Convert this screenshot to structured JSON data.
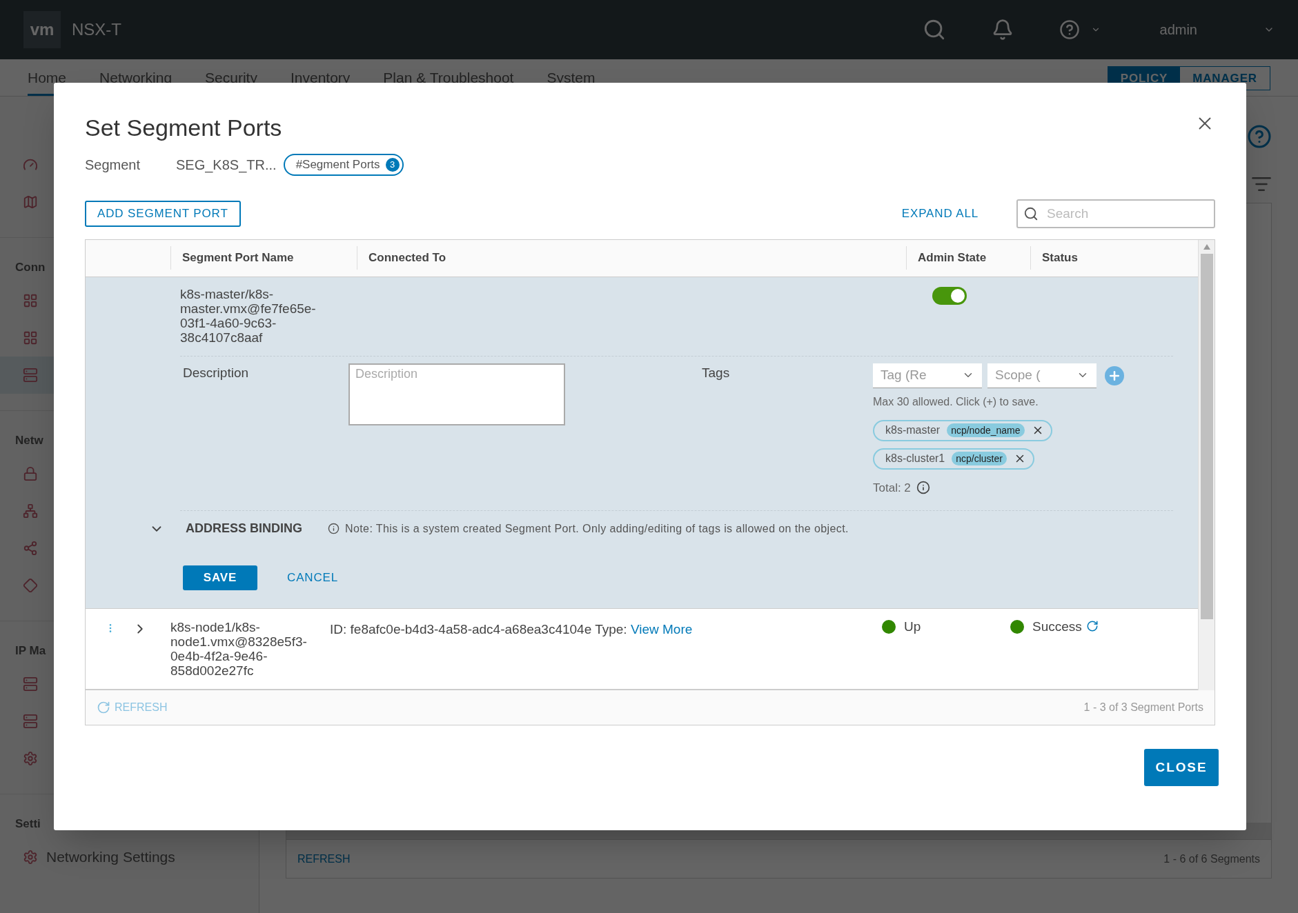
{
  "header": {
    "logo": "vm",
    "app_name": "NSX-T",
    "user": "admin"
  },
  "nav": {
    "tabs": [
      {
        "label": "Home",
        "selected": true
      },
      {
        "label": "Networking",
        "selected": false
      },
      {
        "label": "Security",
        "selected": false
      },
      {
        "label": "Inventory",
        "selected": false
      },
      {
        "label": "Plan & Troubleshoot",
        "selected": false
      },
      {
        "label": "System",
        "selected": false
      }
    ],
    "modes": [
      {
        "label": "POLICY",
        "selected": true
      },
      {
        "label": "MANAGER",
        "selected": false
      }
    ]
  },
  "sidebar": {
    "groups": [
      {
        "items": [
          {
            "selected": false
          },
          {
            "selected": false
          }
        ]
      },
      {
        "heading": "Conn",
        "items": [
          {
            "selected": false
          },
          {
            "selected": false
          },
          {
            "selected": true
          }
        ]
      },
      {
        "heading": "Netw",
        "items": [
          {
            "selected": false
          },
          {
            "selected": false
          },
          {
            "selected": false
          },
          {
            "selected": false
          }
        ]
      },
      {
        "heading": "IP Ma",
        "items": [
          {
            "selected": false
          },
          {
            "selected": false
          },
          {
            "selected": false
          }
        ]
      },
      {
        "heading": "Setti",
        "items": [
          {
            "label": "Networking Settings",
            "selected": false
          }
        ]
      }
    ]
  },
  "background_table": {
    "refresh": "REFRESH",
    "count": "1 - 6 of 6 Segments"
  },
  "dialog": {
    "title": "Set Segment Ports",
    "segment_label": "Segment",
    "segment_value": "SEG_K8S_TR...",
    "ports_badge": {
      "label": "#Segment Ports",
      "count": "3"
    },
    "add_button": "ADD SEGMENT PORT",
    "expand_all": "EXPAND ALL",
    "search": {
      "placeholder": "Search"
    },
    "columns": [
      "Segment Port Name",
      "Connected To",
      "Admin State",
      "Status"
    ],
    "rows": [
      {
        "expanded": true,
        "name": "k8s-master/k8s-master.vmx@fe7fe65e-03f1-4a60-9c63-38c4107c8aaf",
        "admin_on": true,
        "detail": {
          "description_label": "Description",
          "description_placeholder": "Description",
          "tags_label": "Tags",
          "tag_placeholder": "Tag (Re",
          "scope_placeholder": "Scope (",
          "hint": "Max 30 allowed. Click (+) to save.",
          "tags": [
            {
              "tag": "k8s-master",
              "scope": "ncp/node_name"
            },
            {
              "tag": "k8s-cluster1",
              "scope": "ncp/cluster"
            }
          ],
          "total": "Total: 2",
          "address_binding": {
            "label": "ADDRESS BINDING",
            "expanded": true
          },
          "note": "Note: This is a system created Segment Port. Only adding/editing of tags is allowed on the object.",
          "save": "SAVE",
          "cancel": "CANCEL"
        }
      },
      {
        "expanded": false,
        "name": "k8s-node1/k8s-node1.vmx@8328e5f3-0e4b-4f2a-9e46-858d002e27fc",
        "connected_to": "ID: fe8afc0e-b4d3-4a58-adc4-a68ea3c4104e Type:",
        "connected_link": "View More",
        "admin_state": {
          "label": "Up",
          "color": "#318700"
        },
        "status": {
          "label": "Success",
          "color": "#318700"
        }
      }
    ],
    "footer": {
      "refresh": "REFRESH",
      "count": "1 - 3 of 3 Segment Ports"
    },
    "close_button": "CLOSE"
  }
}
